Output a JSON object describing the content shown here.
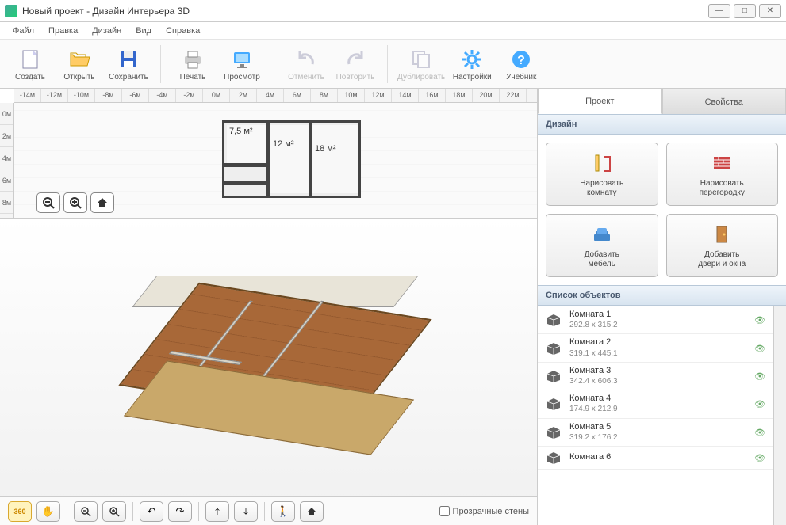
{
  "window": {
    "title": "Новый проект - Дизайн Интерьера 3D"
  },
  "menu": {
    "file": "Файл",
    "edit": "Правка",
    "design": "Дизайн",
    "view": "Вид",
    "help": "Справка"
  },
  "toolbar": {
    "create": "Создать",
    "open": "Открыть",
    "save": "Сохранить",
    "print": "Печать",
    "preview": "Просмотр",
    "undo": "Отменить",
    "redo": "Повторить",
    "duplicate": "Дублировать",
    "settings": "Настройки",
    "tutorial": "Учебник"
  },
  "ruler_top": [
    "-14м",
    "-12м",
    "-10м",
    "-8м",
    "-6м",
    "-4м",
    "-2м",
    "0м",
    "2м",
    "4м",
    "6м",
    "8м",
    "10м",
    "12м",
    "14м",
    "16м",
    "18м",
    "20м",
    "22м"
  ],
  "ruler_left": [
    "0м",
    "2м",
    "4м",
    "6м",
    "8м"
  ],
  "rooms2d": {
    "r1": "7,5 м²",
    "r2": "12 м²",
    "r3": "18 м²"
  },
  "bottom": {
    "transparent_walls": "Прозрачные стены"
  },
  "tabs": {
    "project": "Проект",
    "properties": "Свойства"
  },
  "sections": {
    "design": "Дизайн",
    "objects": "Список объектов"
  },
  "design_buttons": {
    "draw_room": "Нарисовать\nкомнату",
    "draw_partition": "Нарисовать\nперегородку",
    "add_furniture": "Добавить\nмебель",
    "add_doors": "Добавить\nдвери и окна"
  },
  "objects": [
    {
      "name": "Комната 1",
      "dims": "292.8 x 315.2"
    },
    {
      "name": "Комната 2",
      "dims": "319.1 x 445.1"
    },
    {
      "name": "Комната 3",
      "dims": "342.4 x 606.3"
    },
    {
      "name": "Комната 4",
      "dims": "174.9 x 212.9"
    },
    {
      "name": "Комната 5",
      "dims": "319.2 x 176.2"
    },
    {
      "name": "Комната 6",
      "dims": ""
    }
  ]
}
